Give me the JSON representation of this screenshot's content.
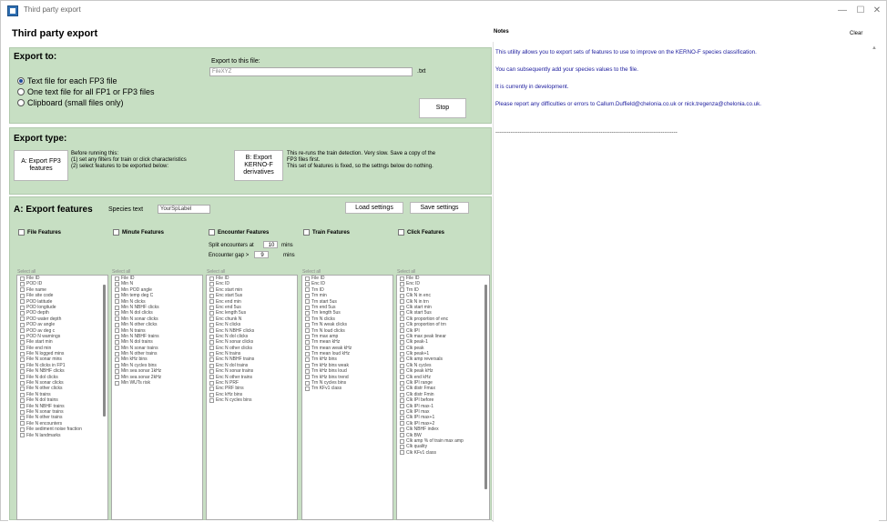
{
  "window": {
    "title": "Third party export",
    "controls": [
      "—",
      "☐",
      "✕"
    ]
  },
  "header": {
    "title": "Third party export"
  },
  "export_to": {
    "title": "Export to:",
    "options": [
      "Text file for each FP3 file",
      "One text file for all FP1 or FP3 files",
      "Clipboard (small files only)"
    ],
    "selected_index": 0,
    "file_label": "Export to this file:",
    "file_value": "FileXYZ",
    "file_ext": ".txt",
    "stop_label": "Stop"
  },
  "export_type": {
    "title": "Export type:",
    "a_button": "A:  Export FP3\nfeatures",
    "a_text": "Before running this:\n(1) set any filters for train or click characteristics\n(2)  select features to be exported below:",
    "b_button": "B:  Export\nKERNO-F\nderivatives",
    "b_text": "This re-runs the train detection. Very slow. Save a copy of the\nFP3 files first.\nThis set of features is fixed, so the settngs below do nothing."
  },
  "features": {
    "title": "A:  Export features",
    "species_label": "Species text",
    "species_value": "YourSpLabel",
    "load_settings": "Load settings",
    "save_settings": "Save settings",
    "split_label": "Split encounters at",
    "split_value": "10",
    "split_unit": "mins",
    "gap_label": "Encounter gap >",
    "gap_value": "9",
    "gap_unit": "mins",
    "select_all": "Select all",
    "columns": [
      {
        "header": "File Features",
        "items": [
          "File ID",
          "POD ID",
          "File name",
          "File site code",
          "POD latitude",
          "POD longitude",
          "POD depth",
          "POD water depth",
          "POD av angle",
          "POD av deg c",
          "POD N warnings",
          "File start min",
          "File end min",
          "File N logged mins",
          "File N sonar mins",
          "File N clicks in FP1",
          "File N NBHF clicks",
          "File N dol clicks",
          "File N sonar clicks",
          "File N other clicks",
          "File N trains",
          "File N dol trains",
          "File N NBHF trains",
          "File N sonar trains",
          "File N other trains",
          "File N encounters",
          "File sediment noise fraction",
          "File N landmarks"
        ]
      },
      {
        "header": "Minute Features",
        "items": [
          "File ID",
          "Min N",
          "Min POD angle",
          "Min temp deg C",
          "Min N clicks",
          "Min N NBHF clicks",
          "Min N dol clicks",
          "Min N sonar clicks",
          "Min N other clicks",
          "Min N trains",
          "Min N NBHF trains",
          "Min N dol trains",
          "Min N sonar trains",
          "Min N other trains",
          "Min kHz bins",
          "Min N cycles bins",
          "Min sea sonar 1kHz",
          "Min sea sonar 2kHz",
          "Min WUTs risk"
        ]
      },
      {
        "header": "Encounter Features",
        "items": [
          "File ID",
          "Enc ID",
          "Enc start min",
          "Enc start 5us",
          "Enc end min",
          "Enc end 5us",
          "Enc length 5us",
          "Enc chunk N",
          "Enc N clicks",
          "Enc N NBHF clicks",
          "Enc N dol clicks",
          "Enc N sonar clicks",
          "Enc N other clicks",
          "Enc N trains",
          "Enc N NBHF trains",
          "Enc N dol trains",
          "Enc N sonar trains",
          "Enc N other trains",
          "Enc N PRF",
          "Enc PRF bins",
          "Enc kHz bins",
          "Enc N cycles bins"
        ]
      },
      {
        "header": "Train Features",
        "items": [
          "File ID",
          "Enc ID",
          "Trn ID",
          "Trn min",
          "Trn start 5us",
          "Trn end 5us",
          "Trn length 5us",
          "Trn N clicks",
          "Trn N weak clicks",
          "Trn N loud clicks",
          "Trn max amp",
          "Trn mean kHz",
          "Trn mean weak kHz",
          "Trn mean loud kHz",
          "Trn kHz bins",
          "Trn kHz bins weak",
          "Trn kHz bins loud",
          "Trn kHz bins trend",
          "Trn N cycles bins",
          "Trn KFv1 class"
        ]
      },
      {
        "header": "Click Features",
        "items": [
          "File ID",
          "Enc ID",
          "Trn ID",
          "Clk N in enc",
          "Clk N in trn",
          "Clk start min",
          "Clk start 5us",
          "Clk proportion of enc",
          "Clk proportion of trn",
          "Clk IPI",
          "Clk max peak linear",
          "Clk peak-1",
          "Clk peak",
          "Clk peak+1",
          "Clk amp reversals",
          "Clk N cycles",
          "Clk peak kHz",
          "Clk end kHz",
          "Clk IPI range",
          "Clk distr Fmax",
          "Clk distr Fmin",
          "Clk IPI before",
          "Clk IPI max-1",
          "Clk IPI max",
          "Clk IPI max+1",
          "Clk IPI max+2",
          "Clk NBHF index",
          "Clk BW",
          "Clk amp % of train max amp",
          "Clk quality",
          "Clk KFv1 class"
        ]
      }
    ]
  },
  "notes": {
    "header": "Notes",
    "clear_label": "Clear",
    "lines": [
      "This utility allows you to export sets of features to use to improve on the KERNO-F species classification.",
      "You can subsequently add your species values to the file.",
      "It is currently in development.",
      "Please report any difficulties or errors to Callum.Duffield@chelonia.co.uk or nick.tregenza@chelonia.co.uk.",
      "-------------------------------------------------------------------------------------------------"
    ]
  }
}
